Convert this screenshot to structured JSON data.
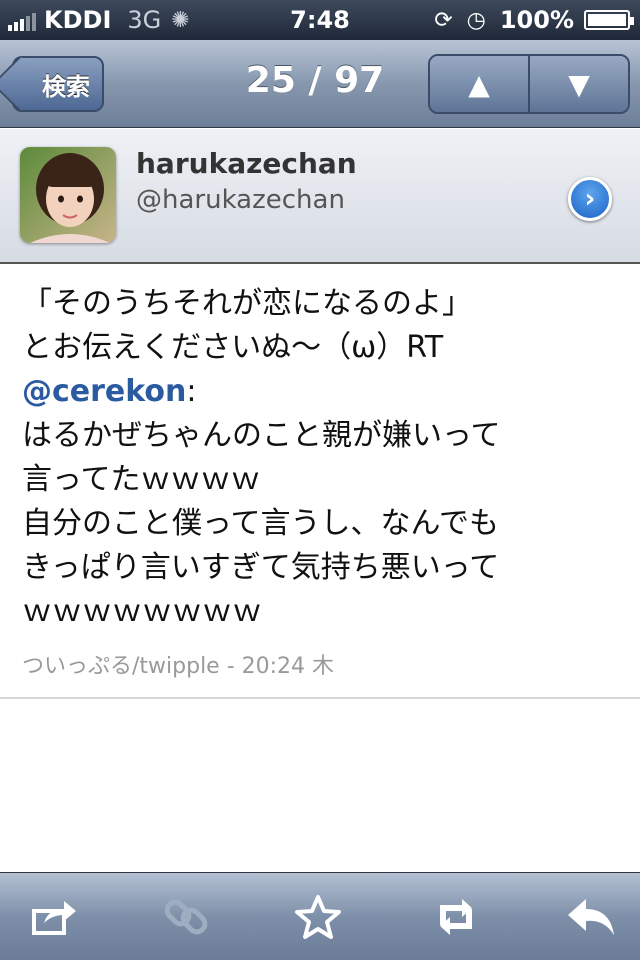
{
  "status_bar": {
    "carrier": "KDDI",
    "network": "3G",
    "time": "7:48",
    "battery": "100%",
    "icons": [
      "signal-icon",
      "activity-spinner-icon",
      "rotation-lock-icon",
      "alarm-icon",
      "battery-icon"
    ]
  },
  "nav": {
    "back_label": "検索",
    "title": "25 / 97",
    "up_icon": "▲",
    "down_icon": "▼"
  },
  "profile": {
    "display_name": "harukazechan",
    "screen_name": "@harukazechan",
    "detail_icon": "›"
  },
  "tweet": {
    "lines": [
      "「そのうちそれが恋になるのよ」",
      "とお伝えくださいぬ〜（ω）RT"
    ],
    "mention": "@cerekon",
    "mention_suffix": ":",
    "body_lines": [
      "はるかぜちゃんのこと親が嫌いって",
      "言ってたｗｗｗｗ",
      "自分のこと僕って言うし、なんでも",
      "きっぱり言いすぎて気持ち悪いって",
      "ｗｗｗｗｗｗｗｗ"
    ],
    "meta": "ついっぷる/twipple - 20:24 木"
  },
  "toolbar": {
    "items": [
      {
        "name": "share-icon",
        "glyph": "⇪",
        "enabled": true
      },
      {
        "name": "link-icon",
        "glyph": "∞",
        "enabled": false
      },
      {
        "name": "favorite-star-icon",
        "glyph": "☆",
        "enabled": true
      },
      {
        "name": "retweet-icon",
        "glyph": "⟲",
        "enabled": true
      },
      {
        "name": "reply-icon",
        "glyph": "↩",
        "enabled": true
      }
    ]
  },
  "colors": {
    "nav_gradient_top": "#b9c5d6",
    "nav_gradient_bottom": "#6d7f98",
    "mention": "#2a5aa0",
    "meta_text": "#9a9a9a",
    "detail_button": "#1a63c7"
  }
}
